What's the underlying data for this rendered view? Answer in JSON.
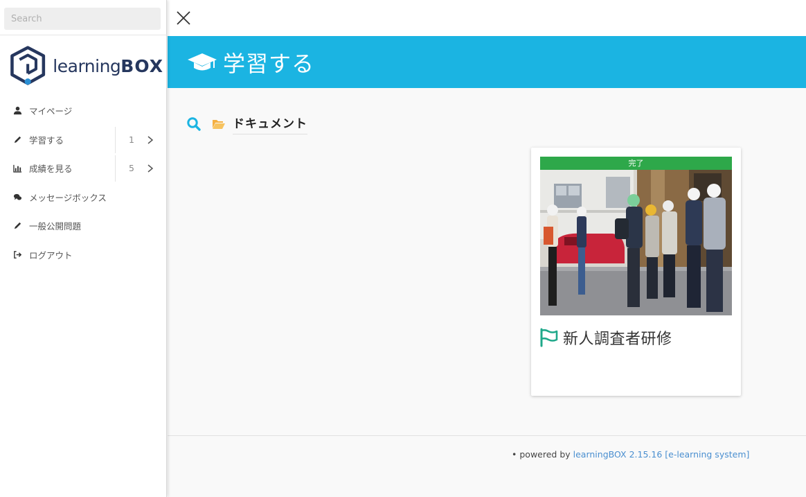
{
  "sidebar": {
    "search_placeholder": "Search",
    "logo": {
      "text_light": "learning",
      "text_bold": "BOX"
    },
    "items": [
      {
        "label": "マイページ",
        "icon": "user-icon"
      },
      {
        "label": "学習する",
        "icon": "pencil-icon",
        "count": "1"
      },
      {
        "label": "成績を見る",
        "icon": "chart-icon",
        "count": "5"
      },
      {
        "label": "メッセージボックス",
        "icon": "comments-icon"
      },
      {
        "label": "一般公開問題",
        "icon": "pencil-icon"
      },
      {
        "label": "ログアウト",
        "icon": "sign-out-icon"
      }
    ]
  },
  "header": {
    "title": "学習する",
    "icon": "graduation-cap-icon"
  },
  "breadcrumb": {
    "label": "ドキュメント"
  },
  "card": {
    "badge": "完了",
    "title": "新人調査者研修"
  },
  "footer": {
    "prefix": "powered by",
    "link_product": "learningBOX 2.15.16",
    "link_system": "[e-learning system]"
  },
  "colors": {
    "header_bg": "#1bb4e2",
    "badge_green": "#2ea84a",
    "logo_navy": "#26375e",
    "flag_teal": "#1fa88a",
    "folder_orange": "#f5b041",
    "link_blue": "#4a8fd0"
  }
}
